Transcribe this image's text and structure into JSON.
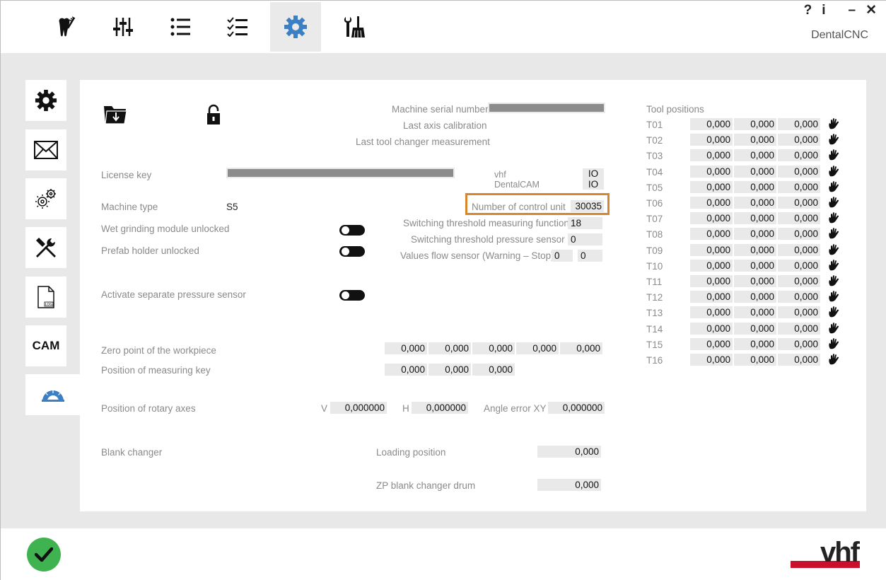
{
  "app": {
    "name": "DentalCNC",
    "help_label": "?",
    "info_label": "i",
    "minimize_label": "–",
    "close_label": "✕"
  },
  "tabs": [
    {
      "icon": "tooth-brush-icon"
    },
    {
      "icon": "sliders-icon"
    },
    {
      "icon": "list-icon"
    },
    {
      "icon": "checklist-icon"
    },
    {
      "icon": "gear-icon",
      "active": true
    },
    {
      "icon": "tools-cleaning-icon"
    }
  ],
  "side_nav": [
    {
      "icon": "gear-icon"
    },
    {
      "icon": "envelope-icon"
    },
    {
      "icon": "gears-icon"
    },
    {
      "icon": "wrench-screwdriver-icon"
    },
    {
      "icon": "log-file-icon",
      "text": "LOG"
    },
    {
      "icon": "cam-icon",
      "label": "CAM"
    },
    {
      "icon": "protractor-icon",
      "active": true
    }
  ],
  "machine": {
    "serial_label": "Machine serial number",
    "last_axis_label": "Last axis calibration",
    "last_tool_changer_label": "Last tool changer measurement",
    "license_label": "License key",
    "vhf_label": "vhf",
    "dentalcam_label": "DentalCAM",
    "vhf_value": "IO",
    "dentalcam_value": "IO",
    "machine_type_label": "Machine type",
    "machine_type_value": "S5",
    "control_unit_label": "Number of control unit",
    "control_unit_value": "30035",
    "wet_grinding_label": "Wet grinding module unlocked",
    "prefab_label": "Prefab holder unlocked",
    "switch_measuring_label": "Switching threshold measuring function",
    "switch_measuring_value": "18",
    "switch_pressure_label": "Switching threshold pressure sensor",
    "switch_pressure_value": "0",
    "flow_sensor_label": "Values flow sensor (Warning – Stop)",
    "flow_warning_value": "0",
    "flow_stop_value": "0",
    "separate_pressure_label": "Activate separate pressure sensor",
    "zero_point_label": "Zero point of the workpiece",
    "zero_point_values": [
      "0,000",
      "0,000",
      "0,000",
      "0,000",
      "0,000"
    ],
    "measuring_key_label": "Position of measuring key",
    "measuring_key_values": [
      "0,000",
      "0,000",
      "0,000"
    ],
    "rotary_axes_label": "Position of rotary axes",
    "v_label": "V",
    "v_value": "0,000000",
    "h_label": "H",
    "h_value": "0,000000",
    "angle_error_label": "Angle error XY",
    "angle_error_value": "0,000000",
    "blank_changer_label": "Blank changer",
    "loading_position_label": "Loading position",
    "loading_position_value": "0,000",
    "zp_blank_label": "ZP blank changer drum",
    "zp_blank_value": "0,000"
  },
  "tool_positions": {
    "title": "Tool positions",
    "tools": [
      {
        "name": "T01",
        "values": [
          "0,000",
          "0,000",
          "0,000"
        ]
      },
      {
        "name": "T02",
        "values": [
          "0,000",
          "0,000",
          "0,000"
        ]
      },
      {
        "name": "T03",
        "values": [
          "0,000",
          "0,000",
          "0,000"
        ]
      },
      {
        "name": "T04",
        "values": [
          "0,000",
          "0,000",
          "0,000"
        ]
      },
      {
        "name": "T05",
        "values": [
          "0,000",
          "0,000",
          "0,000"
        ]
      },
      {
        "name": "T06",
        "values": [
          "0,000",
          "0,000",
          "0,000"
        ]
      },
      {
        "name": "T07",
        "values": [
          "0,000",
          "0,000",
          "0,000"
        ]
      },
      {
        "name": "T08",
        "values": [
          "0,000",
          "0,000",
          "0,000"
        ]
      },
      {
        "name": "T09",
        "values": [
          "0,000",
          "0,000",
          "0,000"
        ]
      },
      {
        "name": "T10",
        "values": [
          "0,000",
          "0,000",
          "0,000"
        ]
      },
      {
        "name": "T11",
        "values": [
          "0,000",
          "0,000",
          "0,000"
        ]
      },
      {
        "name": "T12",
        "values": [
          "0,000",
          "0,000",
          "0,000"
        ]
      },
      {
        "name": "T13",
        "values": [
          "0,000",
          "0,000",
          "0,000"
        ]
      },
      {
        "name": "T14",
        "values": [
          "0,000",
          "0,000",
          "0,000"
        ]
      },
      {
        "name": "T15",
        "values": [
          "0,000",
          "0,000",
          "0,000"
        ]
      },
      {
        "name": "T16",
        "values": [
          "0,000",
          "0,000",
          "0,000"
        ]
      }
    ]
  },
  "logo": {
    "text": "vhf"
  },
  "colors": {
    "accent": "#3b7fc4",
    "highlight": "#d9862a",
    "ok": "#3fb34f",
    "logo_red": "#c8102e"
  }
}
